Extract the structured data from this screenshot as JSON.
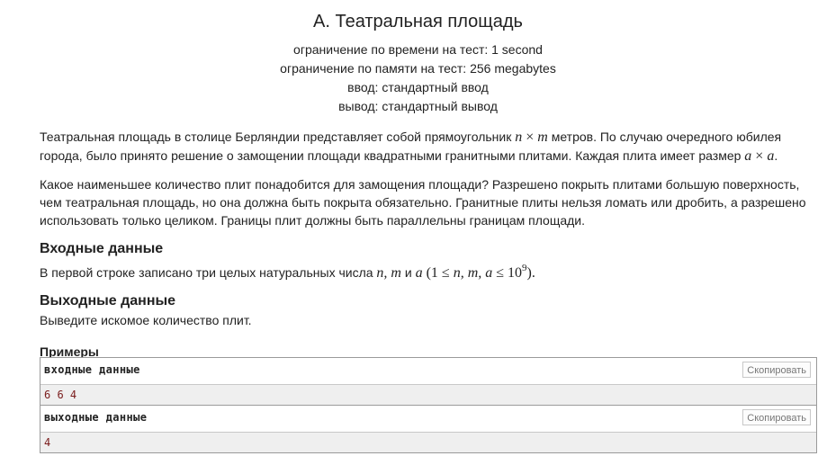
{
  "problem": {
    "title": "A. Театральная площадь",
    "time_limit": "ограничение по времени на тест: 1 second",
    "memory_limit": "ограничение по памяти на тест: 256 megabytes",
    "input_file": "ввод: стандартный ввод",
    "output_file": "вывод: стандартный вывод"
  },
  "statement": {
    "p1_a": "Театральная площадь в столице Берляндии представляет собой прямоугольник ",
    "p1_m1": "n",
    "p1_times": " × ",
    "p1_m2": "m",
    "p1_b": " метров. По случаю очередного юбилея города, было принято решение о замощении площади квадратными гранитными плитами. Каждая плита имеет размер ",
    "p1_m3": "a",
    "p1_m4": "a",
    "p1_c": ".",
    "p2": "Какое наименьшее количество плит понадобится для замощения площади? Разрешено покрыть плитами большую поверхность, чем театральная площадь, но она должна быть покрыта обязательно. Гранитные плиты нельзя ломать или дробить, а разрешено использовать только целиком. Границы плит должны быть параллельны границам площади."
  },
  "input_section": {
    "title": "Входные данные",
    "text_a": "В первой строке записано три целых натуральных числа ",
    "vars": "n, m",
    "and": " и ",
    "var_a": "a",
    "constraint_open": " (1 ≤ ",
    "constraint_vars": "n, m, a",
    "constraint_le": " ≤ 10",
    "constraint_exp": "9",
    "constraint_close": ")."
  },
  "output_section": {
    "title": "Выходные данные",
    "text": "Выведите искомое количество плит."
  },
  "examples": {
    "title": "Примеры",
    "input_label": "входные  данные",
    "input_value": "6 6 4",
    "output_label": "выходные  данные",
    "output_value": "4",
    "copy_label": "Скопировать"
  }
}
